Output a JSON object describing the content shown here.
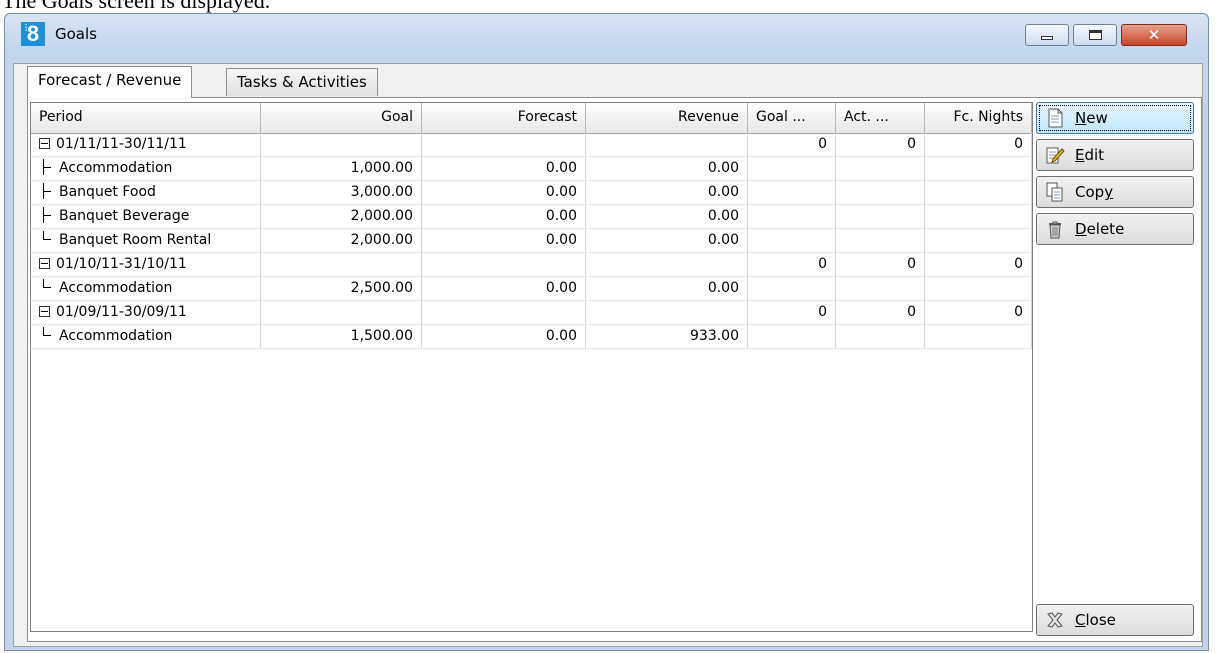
{
  "caption": "The Goals screen is displayed.",
  "window": {
    "title": "Goals",
    "app_icon": "8"
  },
  "tabs": [
    {
      "label": "Forecast / Revenue",
      "active": true
    },
    {
      "label": "Tasks & Activities",
      "active": false
    }
  ],
  "columns": [
    "Period",
    "Goal",
    "Forecast",
    "Revenue",
    "Goal ...",
    "Act. ...",
    "Fc. Nights"
  ],
  "rows": [
    {
      "type": "group",
      "period": "01/11/11-30/11/11",
      "goal": "",
      "forecast": "",
      "revenue": "",
      "goal2": "0",
      "act": "0",
      "nights": "0"
    },
    {
      "type": "child",
      "period": "Accommodation",
      "goal": "1,000.00",
      "forecast": "0.00",
      "revenue": "0.00",
      "goal2": "",
      "act": "",
      "nights": ""
    },
    {
      "type": "child",
      "period": "Banquet Food",
      "goal": "3,000.00",
      "forecast": "0.00",
      "revenue": "0.00",
      "goal2": "",
      "act": "",
      "nights": ""
    },
    {
      "type": "child",
      "period": "Banquet Beverage",
      "goal": "2,000.00",
      "forecast": "0.00",
      "revenue": "0.00",
      "goal2": "",
      "act": "",
      "nights": ""
    },
    {
      "type": "child-last",
      "period": "Banquet Room Rental",
      "goal": "2,000.00",
      "forecast": "0.00",
      "revenue": "0.00",
      "goal2": "",
      "act": "",
      "nights": ""
    },
    {
      "type": "group",
      "period": "01/10/11-31/10/11",
      "goal": "",
      "forecast": "",
      "revenue": "",
      "goal2": "0",
      "act": "0",
      "nights": "0"
    },
    {
      "type": "child-last",
      "period": "Accommodation",
      "goal": "2,500.00",
      "forecast": "0.00",
      "revenue": "0.00",
      "goal2": "",
      "act": "",
      "nights": ""
    },
    {
      "type": "group",
      "period": "01/09/11-30/09/11",
      "goal": "",
      "forecast": "",
      "revenue": "",
      "goal2": "0",
      "act": "0",
      "nights": "0"
    },
    {
      "type": "child-last",
      "period": "Accommodation",
      "goal": "1,500.00",
      "forecast": "0.00",
      "revenue": "933.00",
      "goal2": "",
      "act": "",
      "nights": ""
    }
  ],
  "buttons": {
    "new": {
      "first": "N",
      "rest": "ew",
      "icon": "document-icon"
    },
    "edit": {
      "first": "E",
      "rest": "dit",
      "icon": "edit-pencil-icon"
    },
    "copy": {
      "pre": "Cop",
      "ul": "y",
      "icon": "copy-icon"
    },
    "delete": {
      "first": "D",
      "rest": "elete",
      "icon": "trash-icon"
    },
    "close": {
      "first": "C",
      "rest": "lose",
      "icon": "close-x-icon"
    }
  }
}
